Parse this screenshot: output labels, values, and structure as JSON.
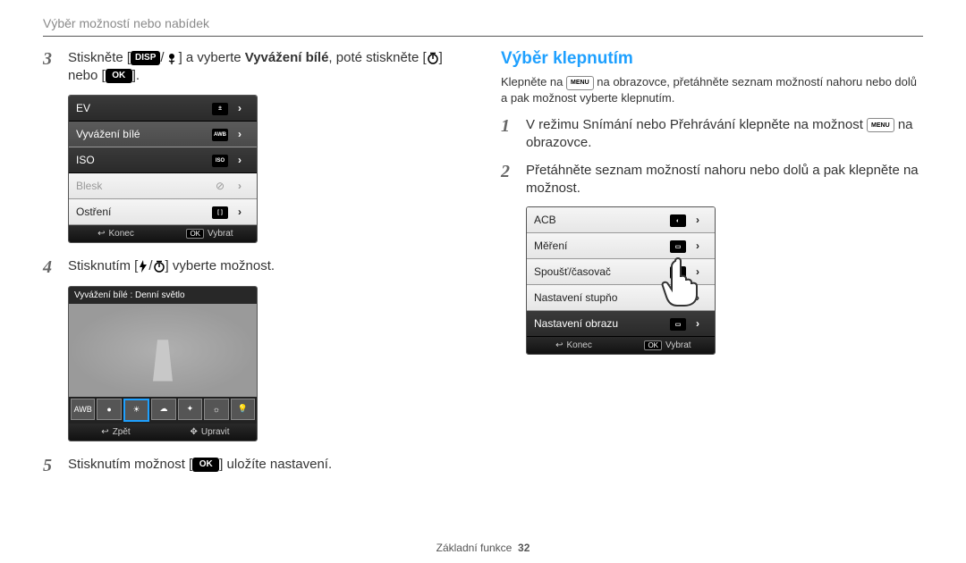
{
  "breadcrumb": "Výběr možností nebo nabídek",
  "left": {
    "step3": {
      "num": "3",
      "pre": "Stiskněte [",
      "key1": "DISP",
      "sep": "/",
      "mid1": "] a vyberte ",
      "bold": "Vyvážení bílé",
      "mid2": ", poté stiskněte [",
      "post": "] nebo [",
      "ok": "OK",
      "end": "]."
    },
    "lcd1_rows": [
      {
        "label": "EV",
        "icon": "±",
        "dark": true
      },
      {
        "label": "Vyvážení bílé",
        "icon": "AWB",
        "sel": true
      },
      {
        "label": "ISO",
        "icon": "ISO",
        "dark": true
      },
      {
        "label": "Blesk",
        "icon": "⊘",
        "disabled": true
      },
      {
        "label": "Ostření",
        "icon": "[ ]"
      }
    ],
    "lcd1_footer_left": "Konec",
    "lcd1_footer_right": "Vybrat",
    "lcd1_ok": "OK",
    "step4": {
      "num": "4",
      "pre": "Stisknutím [",
      "sep": "/",
      "post": "] vyberte možnost."
    },
    "photo_title": "Vyvážení bílé : Denní světlo",
    "thumbs": [
      "AWB",
      "●",
      "☀",
      "☁",
      "✦",
      "☼",
      "💡"
    ],
    "photo_footer_left": "Zpět",
    "photo_footer_right": "Upravit",
    "step5": {
      "num": "5",
      "pre": "Stisknutím možnost [",
      "ok": "OK",
      "post": "] uložíte nastavení."
    }
  },
  "right": {
    "title": "Výběr klepnutím",
    "intro_pre": "Klepněte na ",
    "intro_menu": "MENU",
    "intro_post": " na obrazovce, přetáhněte seznam možností nahoru nebo dolů a pak možnost vyberte klepnutím.",
    "step1": {
      "num": "1",
      "pre": "V režimu Snímání nebo Přehrávání klepněte na možnost ",
      "menu": "MENU",
      "post": " na obrazovce."
    },
    "step2": {
      "num": "2",
      "text": "Přetáhněte seznam možností nahoru nebo dolů a pak klepněte na možnost."
    },
    "lcd_rows": [
      {
        "label": "ACB",
        "icon": "◐"
      },
      {
        "label": "Měření",
        "icon": "▭"
      },
      {
        "label": "Spoušť/časovač",
        "icon": "▭"
      },
      {
        "label": "Nastavení stupňo",
        "icon": "▭"
      },
      {
        "label": "Nastavení obrazu",
        "icon": "▭"
      }
    ],
    "lcd_footer_left": "Konec",
    "lcd_footer_right": "Vybrat",
    "lcd_ok": "OK"
  },
  "footer": {
    "label": "Základní funkce",
    "page": "32"
  }
}
